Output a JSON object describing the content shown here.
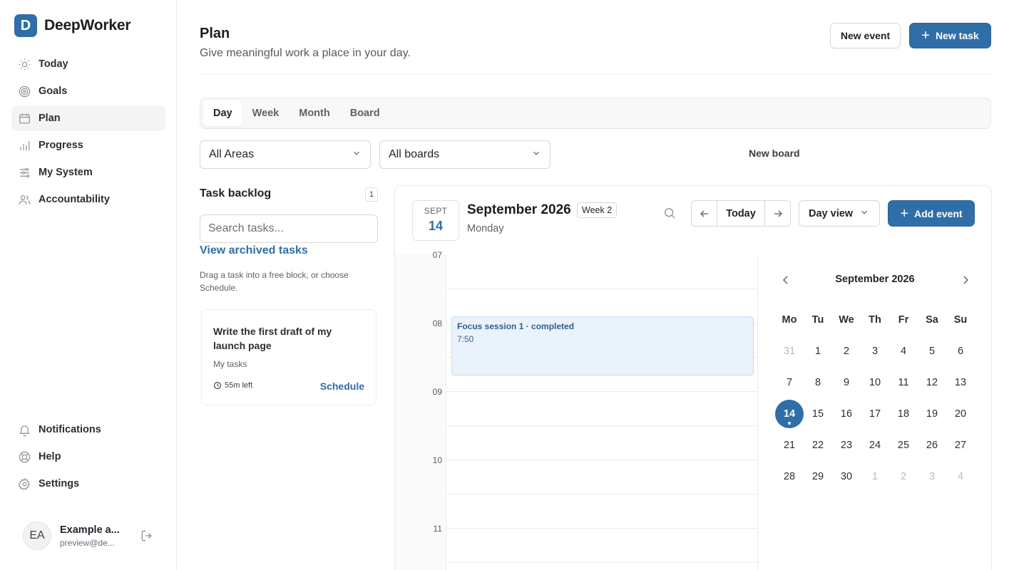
{
  "app": {
    "brand_letter": "D",
    "name": "DeepWorker"
  },
  "sidebar": {
    "items": [
      {
        "label": "Today",
        "icon": "sun-icon"
      },
      {
        "label": "Goals",
        "icon": "target-icon"
      },
      {
        "label": "Plan",
        "icon": "calendar-icon",
        "active": true
      },
      {
        "label": "Progress",
        "icon": "bar-chart-icon"
      },
      {
        "label": "My System",
        "icon": "sliders-icon"
      },
      {
        "label": "Accountability",
        "icon": "users-icon"
      }
    ],
    "bottom_items": [
      {
        "label": "Notifications",
        "icon": "bell-icon"
      },
      {
        "label": "Help",
        "icon": "lifebuoy-icon"
      },
      {
        "label": "Settings",
        "icon": "gear-icon"
      }
    ],
    "user": {
      "initials": "EA",
      "name": "Example a...",
      "email": "preview@de..."
    }
  },
  "header": {
    "title": "Plan",
    "subtitle": "Give meaningful work a place in your day.",
    "new_event_label": "New event",
    "new_task_label": "New task"
  },
  "tabs": [
    "Day",
    "Week",
    "Month",
    "Board"
  ],
  "filters": {
    "areas": "All Areas",
    "boards": "All boards",
    "new_board_label": "New board"
  },
  "backlog": {
    "title": "Task backlog",
    "count": "1",
    "search_placeholder": "Search tasks...",
    "archived_link": "View archived tasks",
    "hint": "Drag a task into a free block, or choose Schedule.",
    "task": {
      "title": "Write the first draft of my launch page",
      "board": "My tasks",
      "time_left": "55m left",
      "schedule_label": "Schedule"
    }
  },
  "calendar": {
    "date_month": "SEPT",
    "date_day": "14",
    "title": "September 2026",
    "week_badge": "Week 2",
    "weekday": "Monday",
    "today_label": "Today",
    "view_label": "Day view",
    "add_event_label": "Add event",
    "hours": [
      "07",
      "08",
      "09",
      "10",
      "11"
    ],
    "event": {
      "title": "Focus session 1 · completed",
      "time": "7:50"
    },
    "mini": {
      "title": "September 2026",
      "weekdays": [
        "Mo",
        "Tu",
        "We",
        "Th",
        "Fr",
        "Sa",
        "Su"
      ],
      "days": [
        {
          "d": "31",
          "muted": true
        },
        {
          "d": "1"
        },
        {
          "d": "2"
        },
        {
          "d": "3"
        },
        {
          "d": "4"
        },
        {
          "d": "5"
        },
        {
          "d": "6"
        },
        {
          "d": "7"
        },
        {
          "d": "8"
        },
        {
          "d": "9"
        },
        {
          "d": "10"
        },
        {
          "d": "11"
        },
        {
          "d": "12"
        },
        {
          "d": "13"
        },
        {
          "d": "14",
          "selected": true
        },
        {
          "d": "15"
        },
        {
          "d": "16"
        },
        {
          "d": "17"
        },
        {
          "d": "18"
        },
        {
          "d": "19"
        },
        {
          "d": "20"
        },
        {
          "d": "21"
        },
        {
          "d": "22"
        },
        {
          "d": "23"
        },
        {
          "d": "24"
        },
        {
          "d": "25"
        },
        {
          "d": "26"
        },
        {
          "d": "27"
        },
        {
          "d": "28"
        },
        {
          "d": "29"
        },
        {
          "d": "30"
        },
        {
          "d": "1",
          "muted": true
        },
        {
          "d": "2",
          "muted": true
        },
        {
          "d": "3",
          "muted": true
        },
        {
          "d": "4",
          "muted": true
        }
      ]
    }
  },
  "colors": {
    "accent": "#2f6ea8",
    "event_bg": "#eaf2fb",
    "event_text": "#2f5f93"
  }
}
